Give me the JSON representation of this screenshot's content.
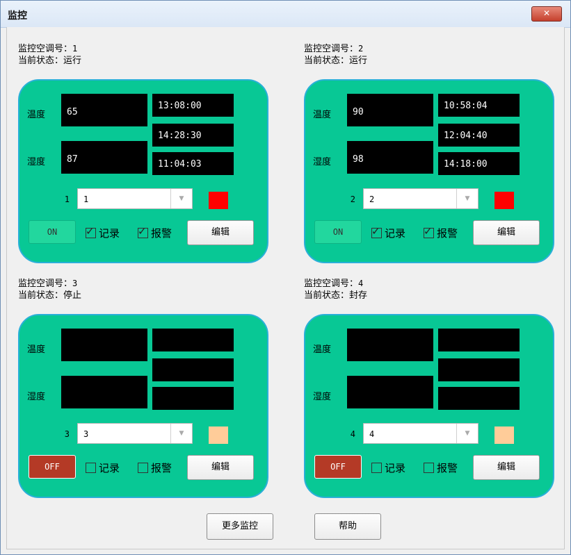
{
  "window": {
    "title": "监控",
    "close_icon": "close-icon (×)"
  },
  "labels": {
    "monitor_prefix": "监控空调号：",
    "status_prefix": "当前状态：",
    "temperature": "温度",
    "humidity": "湿度",
    "record": "记录",
    "alarm": "报警",
    "edit": "编辑",
    "checkmark": "✓",
    "dropdown_arrow": "▼"
  },
  "units": [
    {
      "id": "1",
      "status": "运行",
      "temperature": "65",
      "humidity": "87",
      "times": [
        "13:08:00",
        "14:28:30",
        "11:04:03"
      ],
      "index": "1",
      "selected": "1",
      "power": "ON",
      "power_on": true,
      "record_checked": true,
      "alarm_checked": true,
      "indicator_color": "#ff0000"
    },
    {
      "id": "2",
      "status": "运行",
      "temperature": "90",
      "humidity": "98",
      "times": [
        "10:58:04",
        "12:04:40",
        "14:18:00"
      ],
      "index": "2",
      "selected": "2",
      "power": "ON",
      "power_on": true,
      "record_checked": true,
      "alarm_checked": true,
      "indicator_color": "#ff0000"
    },
    {
      "id": "3",
      "status": "停止",
      "temperature": "",
      "humidity": "",
      "times": [
        "",
        "",
        ""
      ],
      "index": "3",
      "selected": "3",
      "power": "OFF",
      "power_on": false,
      "record_checked": false,
      "alarm_checked": false,
      "indicator_color": "#ffcc99"
    },
    {
      "id": "4",
      "status": "封存",
      "temperature": "",
      "humidity": "",
      "times": [
        "",
        "",
        ""
      ],
      "index": "4",
      "selected": "4",
      "power": "OFF",
      "power_on": false,
      "record_checked": false,
      "alarm_checked": false,
      "indicator_color": "#ffcc99"
    }
  ],
  "footer": {
    "more_monitor": "更多监控",
    "help": "帮助"
  },
  "colors": {
    "panel_bg": "#08c895",
    "panel_border": "#2ab0d8",
    "on_button": "#22d79e",
    "off_button": "#b43a26"
  }
}
